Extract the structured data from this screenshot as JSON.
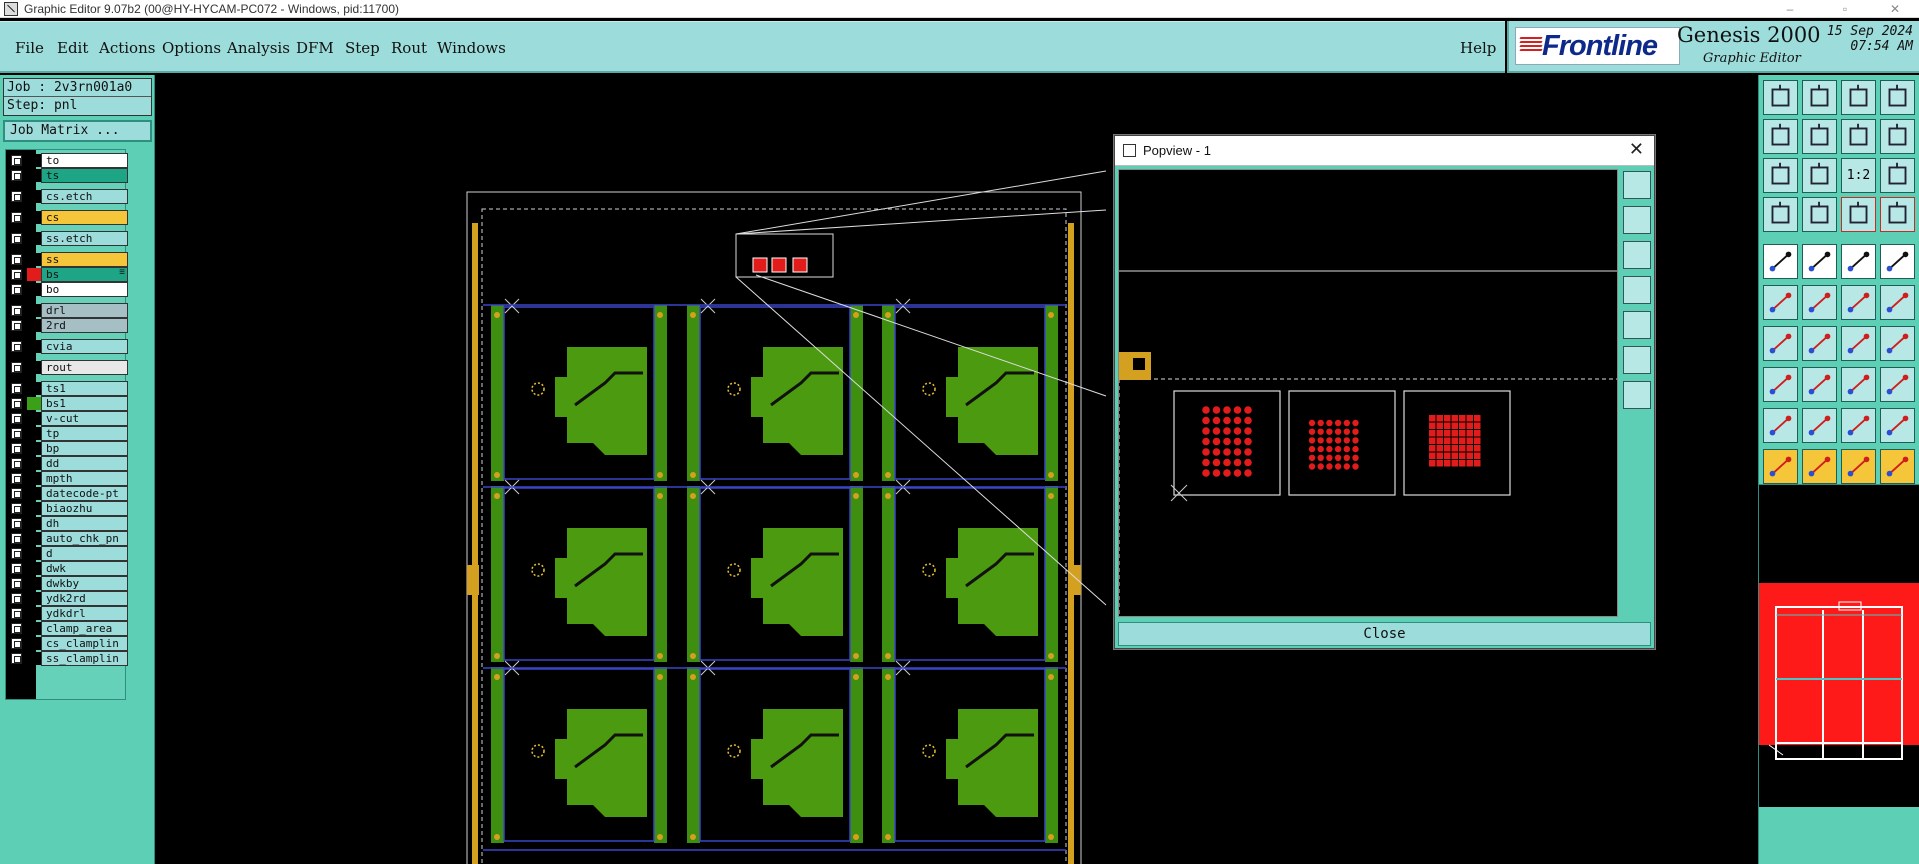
{
  "window": {
    "title": "Graphic Editor 9.07b2 (00@HY-HYCAM-PC072 - Windows, pid:11700)",
    "controls": [
      "–",
      "▫",
      "✕"
    ]
  },
  "menu": {
    "items": [
      "File",
      "Edit",
      "Actions",
      "Options",
      "Analysis",
      "DFM",
      "Step",
      "Rout",
      "Windows"
    ],
    "help": "Help"
  },
  "brand": {
    "logo_text": "Frontline",
    "product": "Genesis 2000",
    "subtitle": "Graphic Editor",
    "date": "15 Sep 2024",
    "time": "07:54 AM"
  },
  "job": {
    "job_label": "Job : 2v3rn001a0",
    "step_label": "Step: pnl",
    "matrix_button": "Job Matrix ..."
  },
  "layers": [
    {
      "name": "to",
      "color": "#ffffff",
      "swatch": "#000000",
      "gap_before": false
    },
    {
      "name": "ts",
      "color": "#1ea585",
      "swatch": "#000000",
      "gap_before": false
    },
    {
      "name": "cs.etch",
      "color": "#9cdcdb",
      "swatch": "#000000",
      "gap_before": true
    },
    {
      "name": "cs",
      "color": "#f5c53a",
      "swatch": "#000000",
      "gap_before": true
    },
    {
      "name": "ss.etch",
      "color": "#9cdcdb",
      "swatch": "#000000",
      "gap_before": true
    },
    {
      "name": "ss",
      "color": "#f5c53a",
      "swatch": "#000000",
      "gap_before": true
    },
    {
      "name": "bs",
      "color": "#1ea585",
      "swatch": "#e21b1b",
      "gap_before": false,
      "marker": "≡"
    },
    {
      "name": "bo",
      "color": "#ffffff",
      "swatch": "#000000",
      "gap_before": false
    },
    {
      "name": "drl",
      "color": "#a6bfc4",
      "swatch": "#000000",
      "gap_before": true
    },
    {
      "name": "2rd",
      "color": "#a6bfc4",
      "swatch": "#000000",
      "gap_before": false
    },
    {
      "name": "cvia",
      "color": "#9cdcdb",
      "swatch": "#000000",
      "gap_before": true
    },
    {
      "name": "rout",
      "color": "#e8e8e8",
      "swatch": "#000000",
      "gap_before": true
    },
    {
      "name": "ts1",
      "color": "#9cdcdb",
      "swatch": "#000000",
      "gap_before": true
    },
    {
      "name": "bs1",
      "color": "#9cdcdb",
      "swatch": "#3aa018",
      "gap_before": false
    },
    {
      "name": "v-cut",
      "color": "#9cdcdb",
      "swatch": "#000000",
      "gap_before": false
    },
    {
      "name": "tp",
      "color": "#9cdcdb",
      "swatch": "#000000",
      "gap_before": false
    },
    {
      "name": "bp",
      "color": "#9cdcdb",
      "swatch": "#000000",
      "gap_before": false
    },
    {
      "name": "dd",
      "color": "#9cdcdb",
      "swatch": "#000000",
      "gap_before": false
    },
    {
      "name": "mpth",
      "color": "#9cdcdb",
      "swatch": "#000000",
      "gap_before": false
    },
    {
      "name": "datecode-pt",
      "color": "#9cdcdb",
      "swatch": "#000000",
      "gap_before": false
    },
    {
      "name": "biaozhu",
      "color": "#9cdcdb",
      "swatch": "#000000",
      "gap_before": false
    },
    {
      "name": "dh",
      "color": "#9cdcdb",
      "swatch": "#000000",
      "gap_before": false
    },
    {
      "name": "auto_chk_pn",
      "color": "#9cdcdb",
      "swatch": "#000000",
      "gap_before": false
    },
    {
      "name": "d",
      "color": "#9cdcdb",
      "swatch": "#000000",
      "gap_before": false
    },
    {
      "name": "dwk",
      "color": "#9cdcdb",
      "swatch": "#000000",
      "gap_before": false
    },
    {
      "name": "dwkby",
      "color": "#9cdcdb",
      "swatch": "#000000",
      "gap_before": false
    },
    {
      "name": "ydk2rd",
      "color": "#9cdcdb",
      "swatch": "#000000",
      "gap_before": false
    },
    {
      "name": "ydkdrl",
      "color": "#9cdcdb",
      "swatch": "#000000",
      "gap_before": false
    },
    {
      "name": "clamp_area",
      "color": "#9cdcdb",
      "swatch": "#000000",
      "gap_before": false
    },
    {
      "name": "cs_clamplin",
      "color": "#9cdcdb",
      "swatch": "#000000",
      "gap_before": false
    },
    {
      "name": "ss_clamplin",
      "color": "#9cdcdb",
      "swatch": "#000000",
      "gap_before": false
    }
  ],
  "popview": {
    "title": "Popview - 1",
    "close_button": "Close",
    "close_glyph": "✕",
    "tools": [
      "zoom-fit-icon",
      "zoom-in-icon",
      "zoom-out-icon",
      "pan-left-icon",
      "pan-right-icon",
      "zoom-home-icon",
      "zoom-window-icon"
    ]
  },
  "right_toolbar": {
    "group1": [
      "home-up-icon",
      "home-down-icon",
      "home-icon",
      "layout-icon",
      "pan-left-icon",
      "pan-right-icon",
      "split-icon",
      "curve-icon",
      "fit-width-icon",
      "fit-height-icon",
      "ratio-icon",
      "help-icon",
      "snap-icon",
      "grid-icon",
      "align-icon",
      "align-edit-icon"
    ],
    "ratio_label": "1:2",
    "group2": [
      "pad-icon",
      "line-draw-icon",
      "ruler-icon",
      "circle-icon",
      "node-icon",
      "cross-icon",
      "connect-icon",
      "connect2-icon",
      "slope-icon",
      "line-icon",
      "rotate-icon",
      "bracket-icon",
      "select-pad-icon",
      "dash-icon",
      "measure-icon",
      "snap-pad-icon",
      "triangle-icon",
      "text-icon",
      "text2-icon",
      "text3-icon",
      "pointer-icon",
      "pointer2-icon",
      "pointer3-icon",
      "pointer-step-icon"
    ]
  },
  "colors": {
    "panel": "#5ccfb5",
    "menu": "#9cdcdb",
    "copper": "#3e8f10",
    "board_green": "#4c9a10",
    "pad_red": "#e21b1b",
    "pad_gold": "#d4a020",
    "outline_blue": "#3a46c8"
  }
}
